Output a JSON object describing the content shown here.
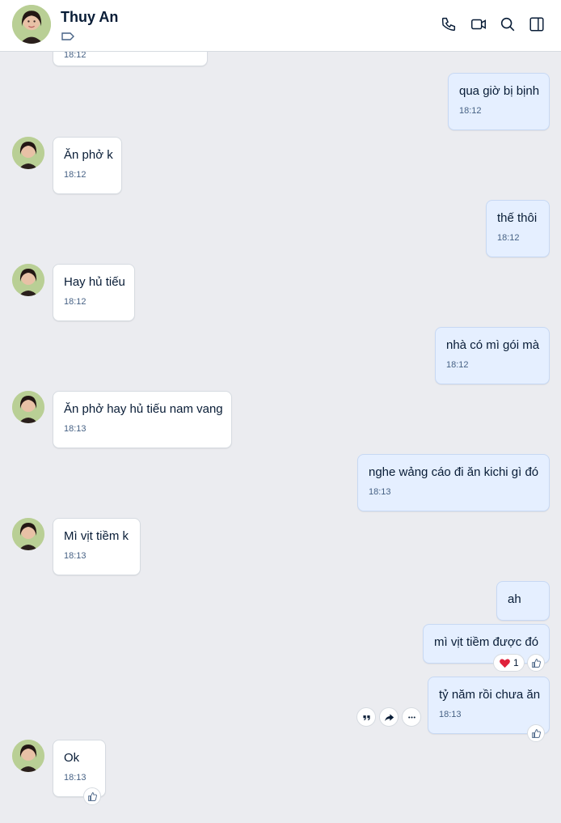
{
  "header": {
    "name": "Thuy An"
  },
  "messages": [
    {
      "side": "in",
      "text": "",
      "time": "18:12"
    },
    {
      "side": "out",
      "text": "qua giờ bị bịnh",
      "time": "18:12"
    },
    {
      "side": "in",
      "text": "Ăn phở k",
      "time": "18:12"
    },
    {
      "side": "out",
      "text": "thế thôi",
      "time": "18:12"
    },
    {
      "side": "in",
      "text": "Hay hủ tiếu",
      "time": "18:12"
    },
    {
      "side": "out",
      "text": "nhà có mì gói mà",
      "time": "18:12"
    },
    {
      "side": "in",
      "text": "Ăn phở hay hủ tiếu nam vang",
      "time": "18:13"
    },
    {
      "side": "out",
      "text": "nghe wảng cáo đi ăn kichi gì đó",
      "time": "18:13"
    },
    {
      "side": "in",
      "text": "Mì vịt tiềm k",
      "time": "18:13"
    },
    {
      "side": "out",
      "text": "ah",
      "time": ""
    },
    {
      "side": "out",
      "text": "mì vịt tiềm được đó",
      "time": ""
    },
    {
      "side": "out",
      "text": "tỷ năm rồi chưa ăn",
      "time": "18:13"
    },
    {
      "side": "in",
      "text": "Ok",
      "time": "18:13"
    }
  ],
  "reaction": {
    "emoji": "heart",
    "count": "1"
  },
  "colors": {
    "accent": "#0068ff",
    "out_bubble": "#e5efff",
    "background": "#ebecf0"
  }
}
